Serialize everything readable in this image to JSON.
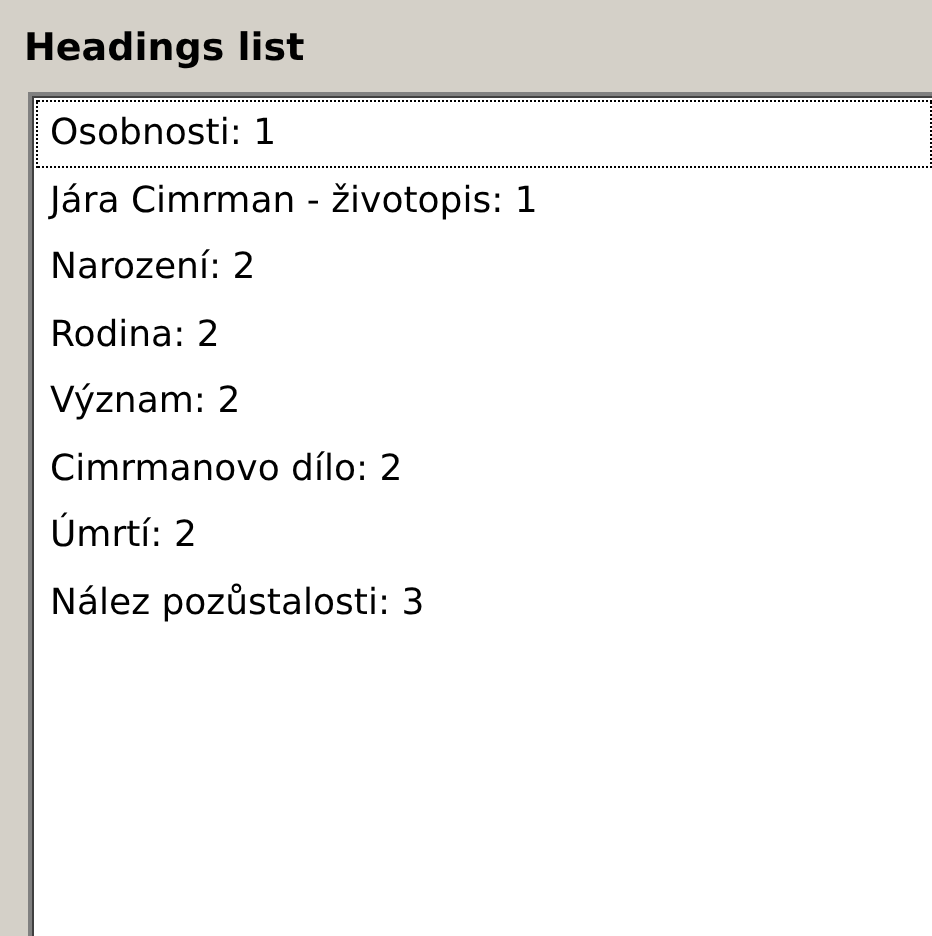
{
  "panel": {
    "title": "Headings list"
  },
  "headings": [
    {
      "label": "Osobnosti: 1",
      "focused": true
    },
    {
      "label": "Jára Cimrman - životopis: 1",
      "focused": false
    },
    {
      "label": "Narození: 2",
      "focused": false
    },
    {
      "label": "Rodina: 2",
      "focused": false
    },
    {
      "label": "Význam: 2",
      "focused": false
    },
    {
      "label": "Cimrmanovo dílo: 2",
      "focused": false
    },
    {
      "label": "Úmrtí: 2",
      "focused": false
    },
    {
      "label": "Nález pozůstalosti: 3",
      "focused": false
    }
  ]
}
